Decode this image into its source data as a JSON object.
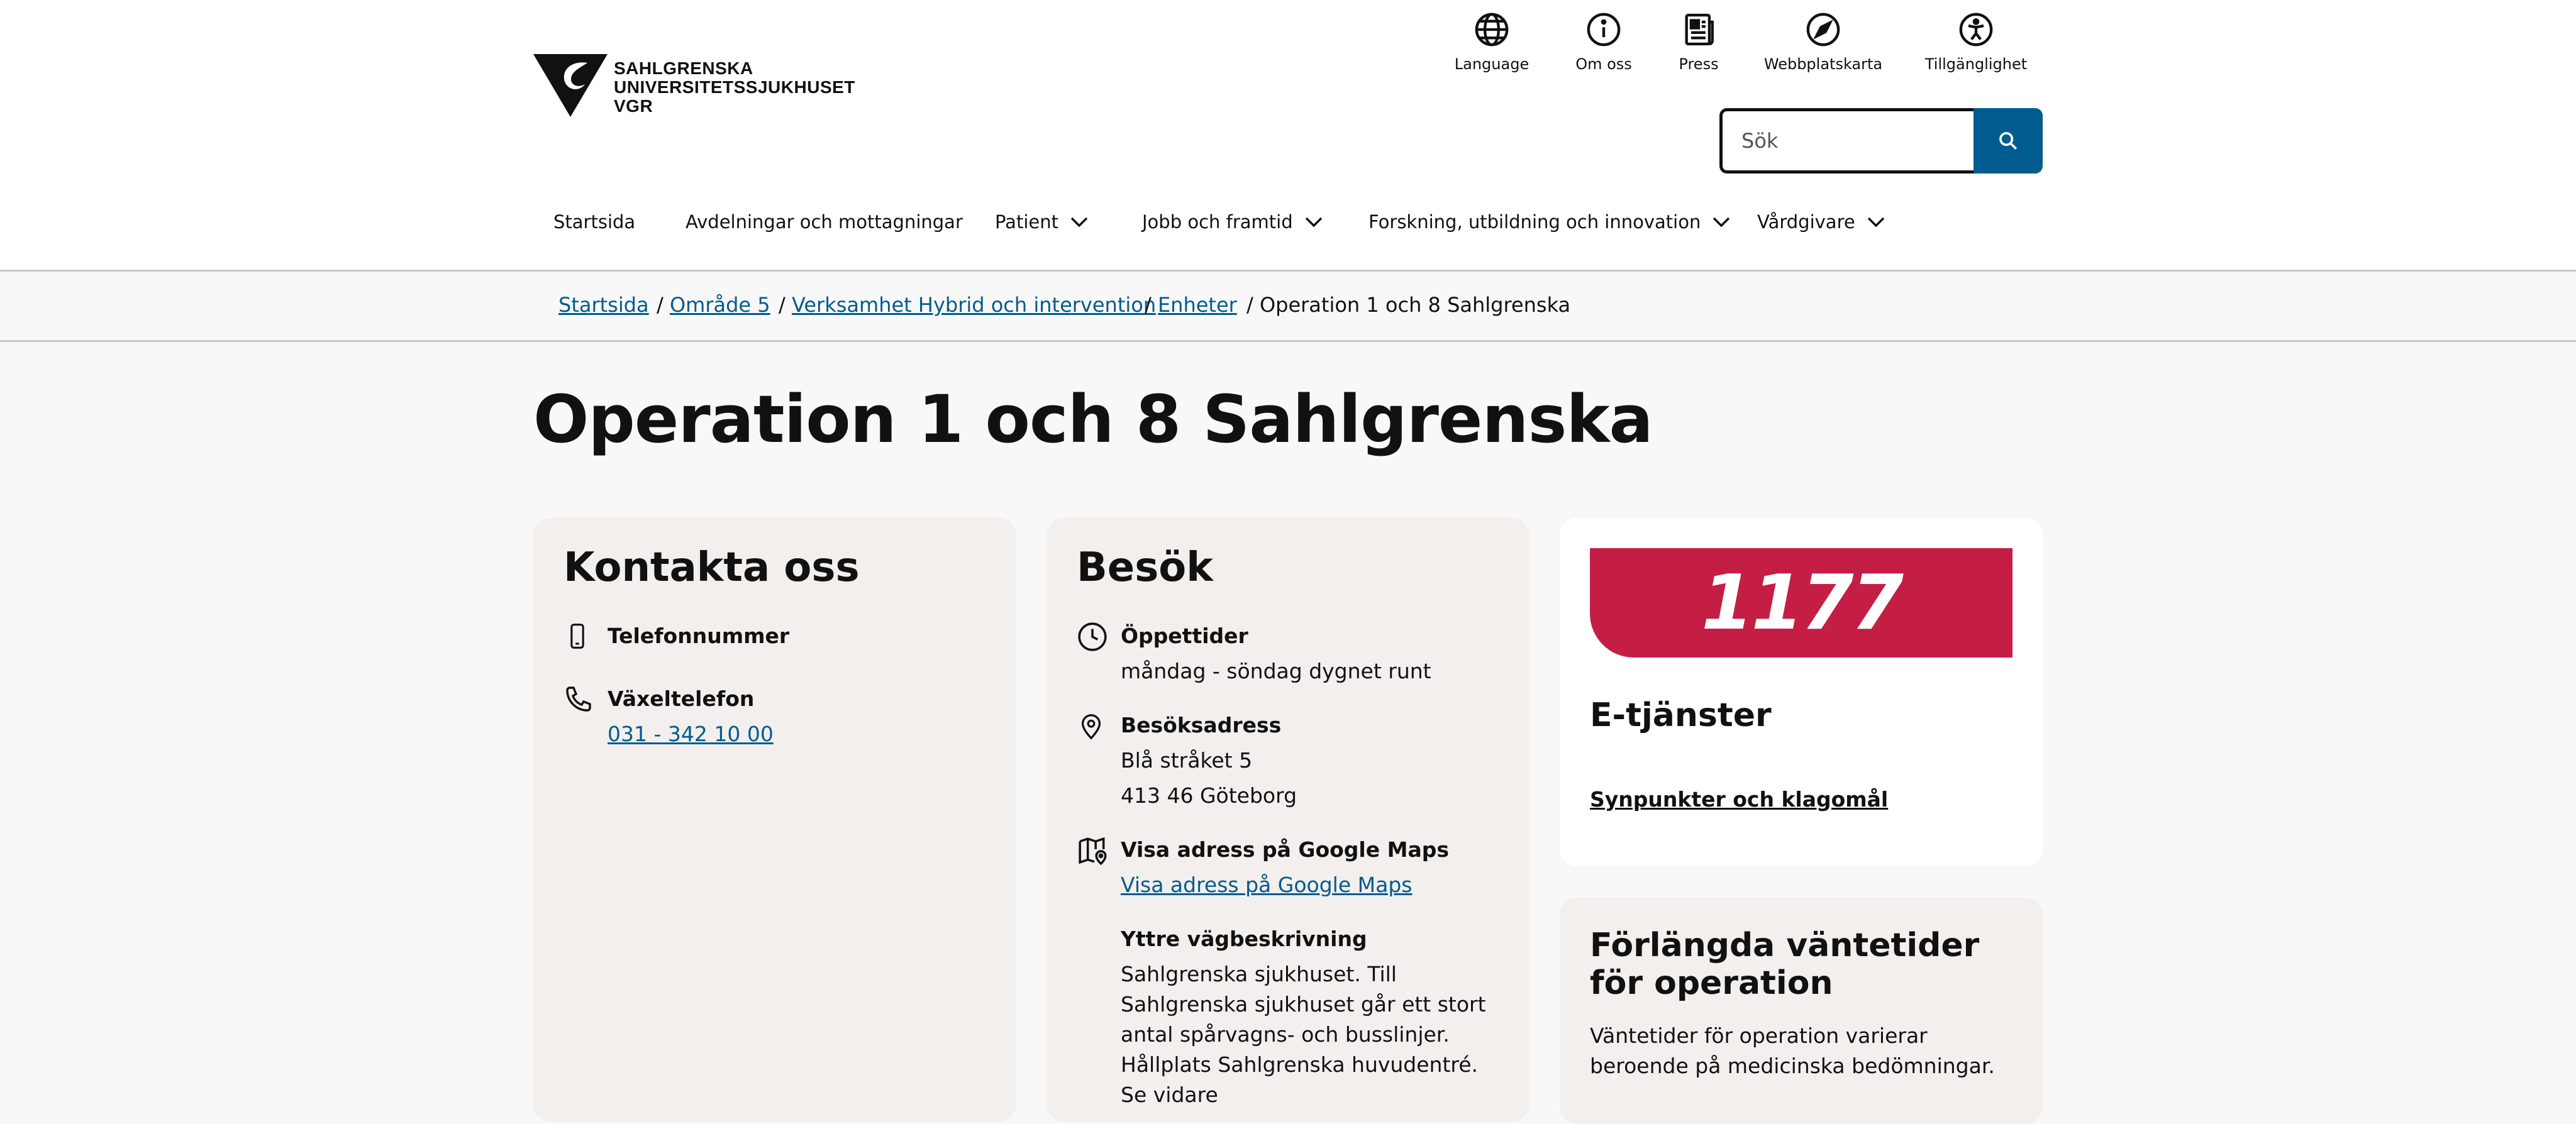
{
  "logo": {
    "line1": "SAHLGRENSKA",
    "line2": "UNIVERSITETSSJUKHUSET",
    "line3": "VGR"
  },
  "utility_nav": [
    {
      "label": "Language",
      "icon": "globe-icon"
    },
    {
      "label": "Om oss",
      "icon": "info-icon"
    },
    {
      "label": "Press",
      "icon": "newspaper-icon"
    },
    {
      "label": "Webbplatskarta",
      "icon": "compass-icon"
    },
    {
      "label": "Tillgänglighet",
      "icon": "accessibility-icon"
    }
  ],
  "search": {
    "placeholder": "Sök",
    "value": ""
  },
  "main_nav": [
    {
      "label": "Startsida",
      "has_dropdown": false
    },
    {
      "label": "Avdelningar och mottagningar",
      "has_dropdown": false
    },
    {
      "label": "Patient",
      "has_dropdown": true
    },
    {
      "label": "Jobb och framtid",
      "has_dropdown": true
    },
    {
      "label": "Forskning, utbildning och innovation",
      "has_dropdown": true
    },
    {
      "label": "Vårdgivare",
      "has_dropdown": true
    }
  ],
  "breadcrumb": {
    "items": [
      "Startsida",
      "Område 5",
      "Verksamhet Hybrid och intervention",
      "Enheter"
    ],
    "current": "Operation 1 och 8 Sahlgrenska",
    "separator": "/"
  },
  "page_title": "Operation 1 och 8 Sahlgrenska",
  "contact": {
    "heading": "Kontakta oss",
    "phone_label": "Telefonnummer",
    "switchboard_label": "Växeltelefon",
    "switchboard_number": "031 - 342 10 00"
  },
  "visit": {
    "heading": "Besök",
    "hours_label": "Öppettider",
    "hours_value": "måndag - söndag dygnet runt",
    "address_label": "Besöksadress",
    "address_line1": "Blå stråket 5",
    "address_line2": "413 46 Göteborg",
    "maps_label": "Visa adress på Google Maps",
    "maps_link": "Visa adress på Google Maps",
    "directions_label": "Yttre vägbeskrivning",
    "directions_text": "Sahlgrenska sjukhuset. Till Sahlgrenska sjukhuset går ett stort antal spårvagns- och busslinjer. Hållplats Sahlgrenska huvudentré. Se vidare"
  },
  "eservices": {
    "badge": "1177",
    "heading": "E-tjänster",
    "link": "Synpunkter och klagomål"
  },
  "waiting": {
    "heading": "Förlängda väntetider för operation",
    "text": "Väntetider för operation varierar beroende på medicinska bedömningar."
  },
  "colors": {
    "link": "#005b8f",
    "search_button": "#005b8f",
    "badge_1177": "#c41e45",
    "card_beige": "#f2efed",
    "page_bg": "#f8f8f8"
  }
}
